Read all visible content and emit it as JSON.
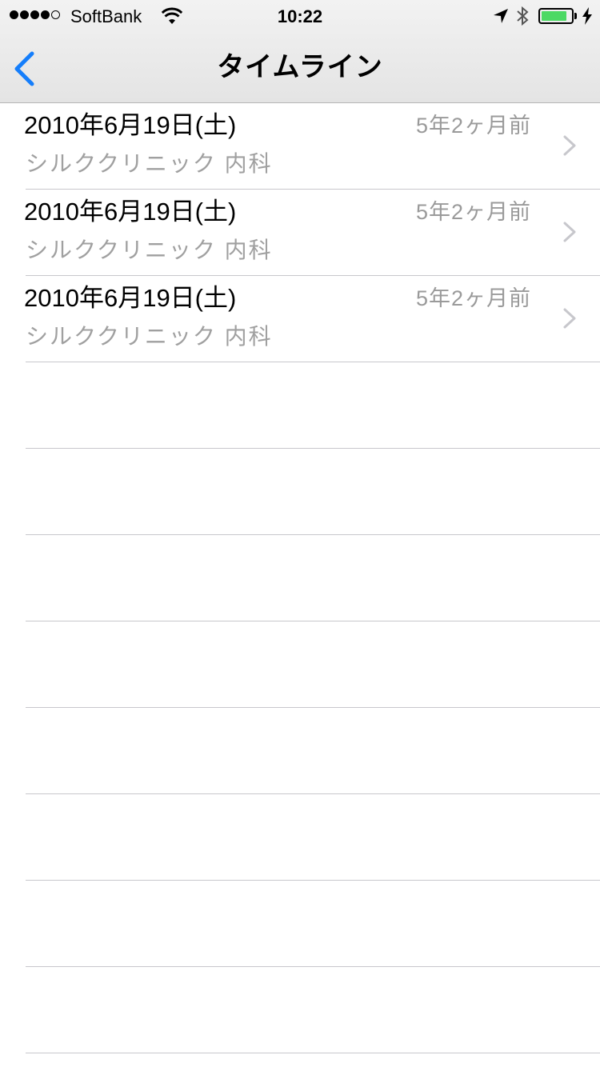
{
  "status_bar": {
    "carrier": "SoftBank",
    "time": "10:22",
    "signal_strength": 4,
    "signal_max": 5,
    "battery_level": 0.85,
    "battery_color": "#4cd964"
  },
  "nav": {
    "title": "タイムライン",
    "back_icon": "chevron-left-icon",
    "accent_color": "#157efb"
  },
  "timeline": {
    "items": [
      {
        "date": "2010年6月19日(土)",
        "ago": "5年2ヶ月前",
        "clinic": "シルククリニック 内科"
      },
      {
        "date": "2010年6月19日(土)",
        "ago": "5年2ヶ月前",
        "clinic": "シルククリニック 内科"
      },
      {
        "date": "2010年6月19日(土)",
        "ago": "5年2ヶ月前",
        "clinic": "シルククリニック 内科"
      }
    ],
    "empty_rows": 8
  }
}
